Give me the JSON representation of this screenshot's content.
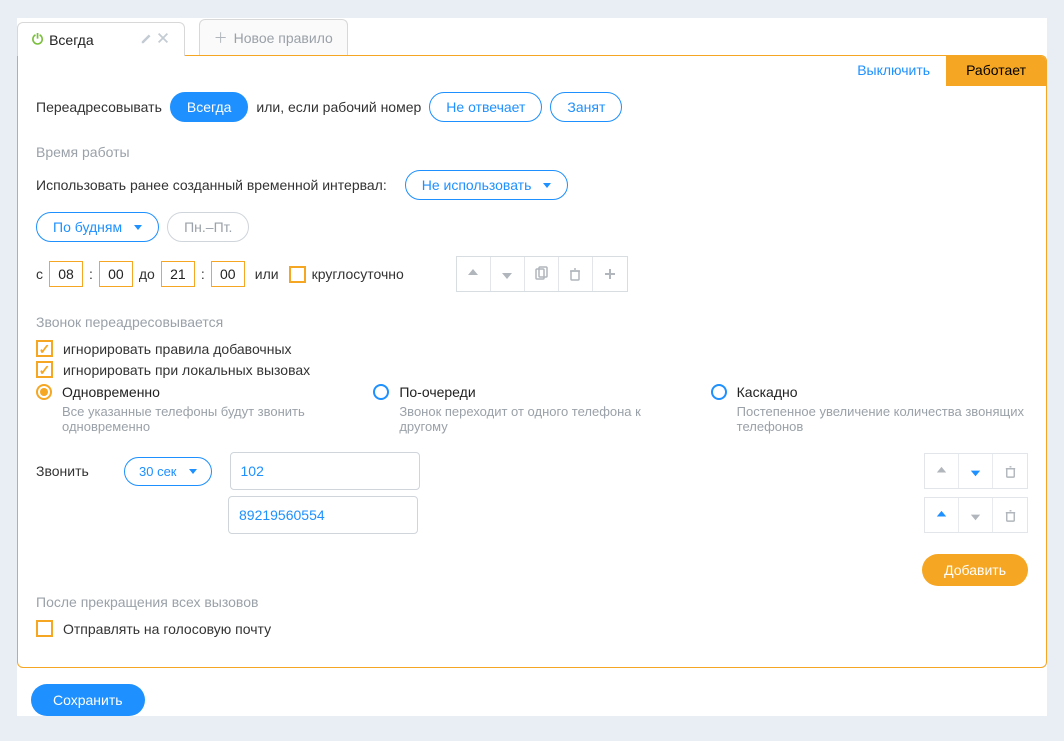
{
  "tabs": {
    "active": {
      "label": "Всегда"
    },
    "new": {
      "label": "Новое правило"
    }
  },
  "status": {
    "off_link": "Выключить",
    "badge": "Работает"
  },
  "forward": {
    "prefix": "Переадресовывать",
    "always": "Всегда",
    "or_text": "или, если рабочий номер",
    "no_answer": "Не отвечает",
    "busy": "Занят"
  },
  "worktime": {
    "heading": "Время работы",
    "use_saved": "Использовать ранее созданный временной интервал:",
    "not_use": "Не использовать",
    "weekdays": "По будням",
    "days_short": "Пн.–Пт.",
    "from": "с",
    "h1": "08",
    "m1": "00",
    "to": "до",
    "h2": "21",
    "m2": "00",
    "or": "или",
    "allday": "круглосуточно"
  },
  "call_fwd": {
    "heading": "Звонок переадресовывается",
    "ignore_ext": "игнорировать правила добавочных",
    "ignore_local": "игнорировать при локальных вызовах",
    "opt1": {
      "title": "Одновременно",
      "desc": "Все указанные телефоны будут звонить одновременно"
    },
    "opt2": {
      "title": "По-очереди",
      "desc": "Звонок переходит от одного телефона к другому"
    },
    "opt3": {
      "title": "Каскадно",
      "desc": "Постепенное увеличение количества звонящих телефонов"
    }
  },
  "dial": {
    "label": "Звонить",
    "duration": "30 сек",
    "numbers": [
      "102",
      "89219560554"
    ],
    "add": "Добавить"
  },
  "post": {
    "heading": "После прекращения всех вызовов",
    "voicemail": "Отправлять на голосовую почту"
  },
  "save": "Сохранить",
  "icons": {
    "power": "power-icon",
    "pencil": "pencil-icon",
    "close": "close-icon",
    "plus": "plus-icon",
    "arrow_up": "arrow-up-icon",
    "arrow_down": "arrow-down-icon",
    "copy": "copy-icon",
    "trash": "trash-icon",
    "chevron": "chevron-down-icon"
  }
}
